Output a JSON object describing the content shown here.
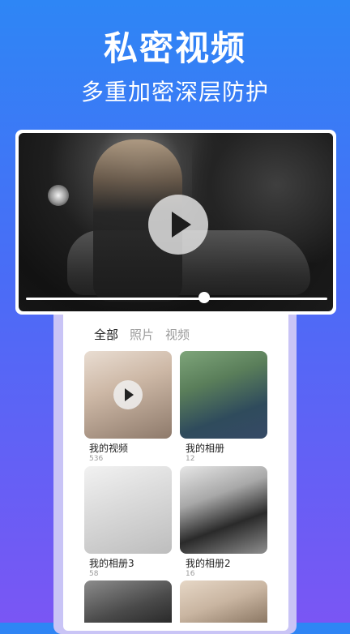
{
  "header": {
    "title": "私密视频",
    "subtitle": "多重加密深层防护"
  },
  "player": {
    "state": "paused",
    "progress": 0.6,
    "play_icon": "play-icon"
  },
  "tabs": [
    {
      "label": "全部",
      "active": true
    },
    {
      "label": "照片",
      "active": false
    },
    {
      "label": "视频",
      "active": false
    }
  ],
  "albums": [
    {
      "label": "我的视频",
      "count": "536",
      "is_video": true
    },
    {
      "label": "我的相册",
      "count": "12",
      "is_video": false
    },
    {
      "label": "我的相册3",
      "count": "58",
      "is_video": false
    },
    {
      "label": "我的相册2",
      "count": "16",
      "is_video": false
    },
    {
      "label": "",
      "count": "",
      "is_video": false
    },
    {
      "label": "",
      "count": "",
      "is_video": false
    }
  ],
  "colors": {
    "bg_top": "#2e86f5",
    "bg_bottom": "#7a56f4",
    "frame": "#c9c4f6",
    "text_active": "#1a1a1a",
    "text_muted": "#9a9a9a"
  }
}
